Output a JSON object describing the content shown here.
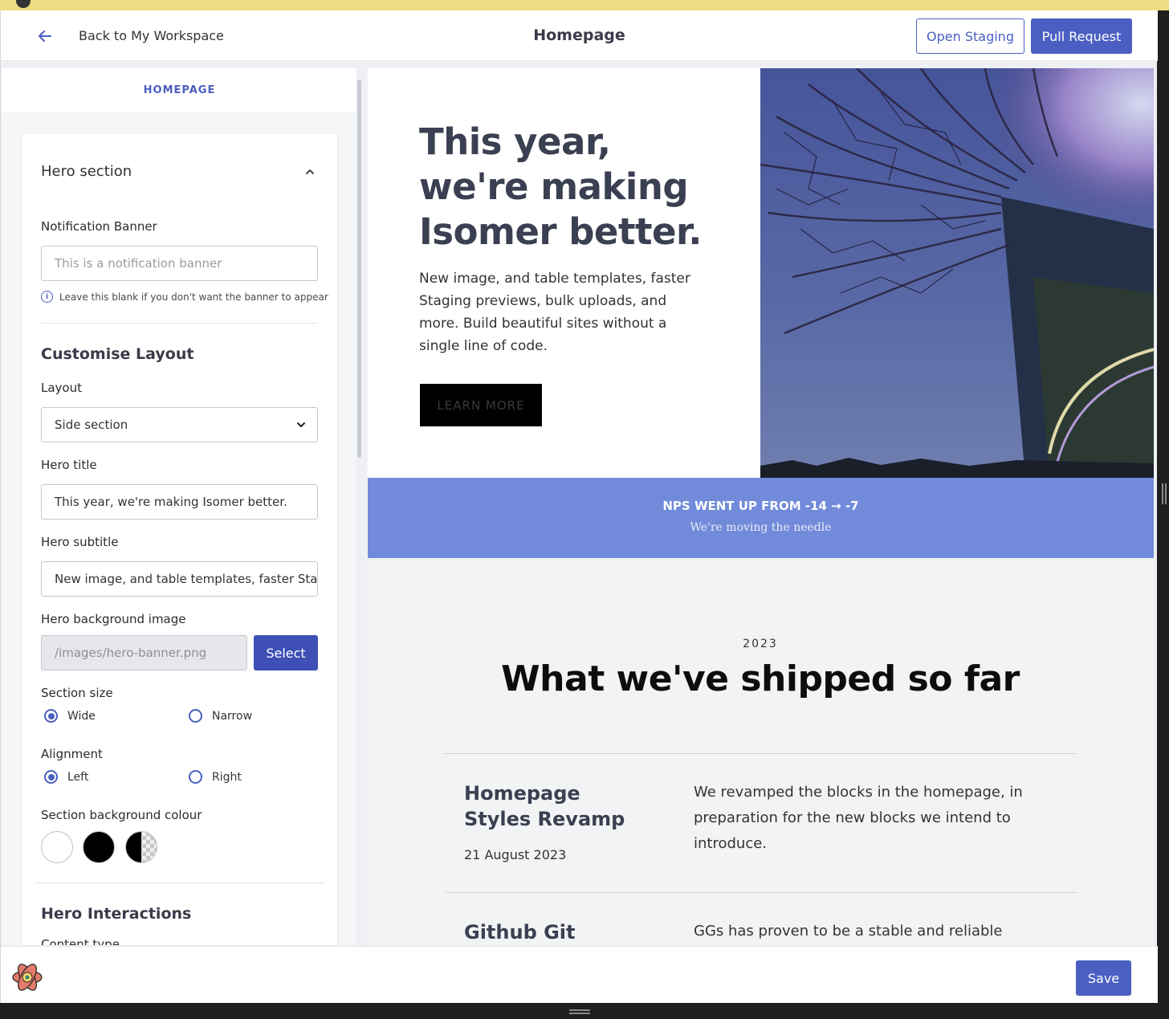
{
  "header": {
    "back_label": "Back to My Workspace",
    "title": "Homepage",
    "open_staging_label": "Open Staging",
    "pull_request_label": "Pull Request"
  },
  "sidebar": {
    "tab_label": "HOMEPAGE",
    "section_title": "Hero section",
    "notification": {
      "label": "Notification Banner",
      "placeholder": "This is a notification banner",
      "hint": "Leave this blank if you don't want the banner to appear"
    },
    "customise_title": "Customise Layout",
    "layout": {
      "label": "Layout",
      "value": "Side section"
    },
    "hero_title": {
      "label": "Hero title",
      "value": "This year, we're making Isomer better."
    },
    "hero_subtitle": {
      "label": "Hero subtitle",
      "value": "New image, and table templates, faster Staging previews, bulk uploads, and more."
    },
    "hero_bg": {
      "label": "Hero background image",
      "value": "/images/hero-banner.png",
      "button": "Select"
    },
    "section_size": {
      "label": "Section size",
      "options": [
        "Wide",
        "Narrow"
      ],
      "selected": "Wide"
    },
    "alignment": {
      "label": "Alignment",
      "options": [
        "Left",
        "Right"
      ],
      "selected": "Left"
    },
    "bg_colour": {
      "label": "Section background colour",
      "swatches": [
        "#ffffff",
        "#000000",
        "transparent"
      ]
    },
    "interactions_title": "Hero Interactions",
    "content_type_label": "Content type"
  },
  "preview": {
    "hero_title": "This year, we're making Isomer better.",
    "hero_subtitle": "New image, and table templates, faster Staging previews, bulk uploads, and more. Build beautiful sites without a single line of code.",
    "learn_more": "LEARN MORE",
    "nps_title": "NPS WENT UP FROM -14 → -7",
    "nps_subtitle": "We're moving the needle",
    "year": "2023",
    "shipped_title": "What we've shipped so far",
    "items": [
      {
        "title": "Homepage Styles Revamp",
        "date": "21 August 2023",
        "desc": "We revamped the blocks in the homepage, in preparation for the new blocks we intend to introduce."
      },
      {
        "title": "Github Git Solution (GGs)",
        "date": "",
        "desc": "GGs has proven to be a stable and reliable solution to our Github token issue. It has now been rolled out"
      }
    ]
  },
  "footer": {
    "save_label": "Save"
  },
  "colors": {
    "accent": "#4a5fc1",
    "nps_band": "#718ad9",
    "top_strip": "#f0dc82"
  }
}
